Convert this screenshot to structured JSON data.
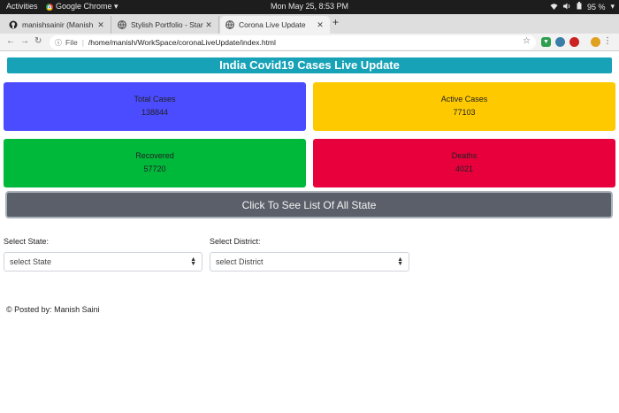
{
  "system_bar": {
    "activities": "Activities",
    "app_name": "Google Chrome ▾",
    "clock": "Mon May 25,  8:53 PM",
    "battery": "95 %"
  },
  "browser": {
    "tabs": [
      {
        "title": "manishsainir (Manish Saini)",
        "favicon": "github-icon"
      },
      {
        "title": "Stylish Portfolio - Start Bootstrap",
        "favicon": "globe-icon"
      },
      {
        "title": "Corona Live Update",
        "favicon": "globe-icon"
      }
    ],
    "new_tab_label": "+",
    "address": {
      "scheme_label": "File",
      "url": "/home/manish/WorkSpace/coronaLiveUpdate/index.html"
    }
  },
  "page": {
    "title": "India Covid19 Cases Live Update",
    "cards": {
      "total": {
        "label": "Total Cases",
        "value": "138844"
      },
      "active": {
        "label": "Active Cases",
        "value": "77103"
      },
      "recovered": {
        "label": "Recovered",
        "value": "57720"
      },
      "deaths": {
        "label": "Deaths",
        "value": "4021"
      }
    },
    "state_list_button": "Click To See List Of All State",
    "state_select": {
      "label": "Select State:",
      "selected": "select State"
    },
    "district_select": {
      "label": "Select District:",
      "selected": "select District"
    },
    "footer": "© Posted by: Manish Saini"
  },
  "colors": {
    "header": "#17a2b8",
    "total": "#4b4bff",
    "active": "#ffc900",
    "recovered": "#00b83a",
    "deaths": "#e8003c",
    "button": "#5a5f69"
  }
}
